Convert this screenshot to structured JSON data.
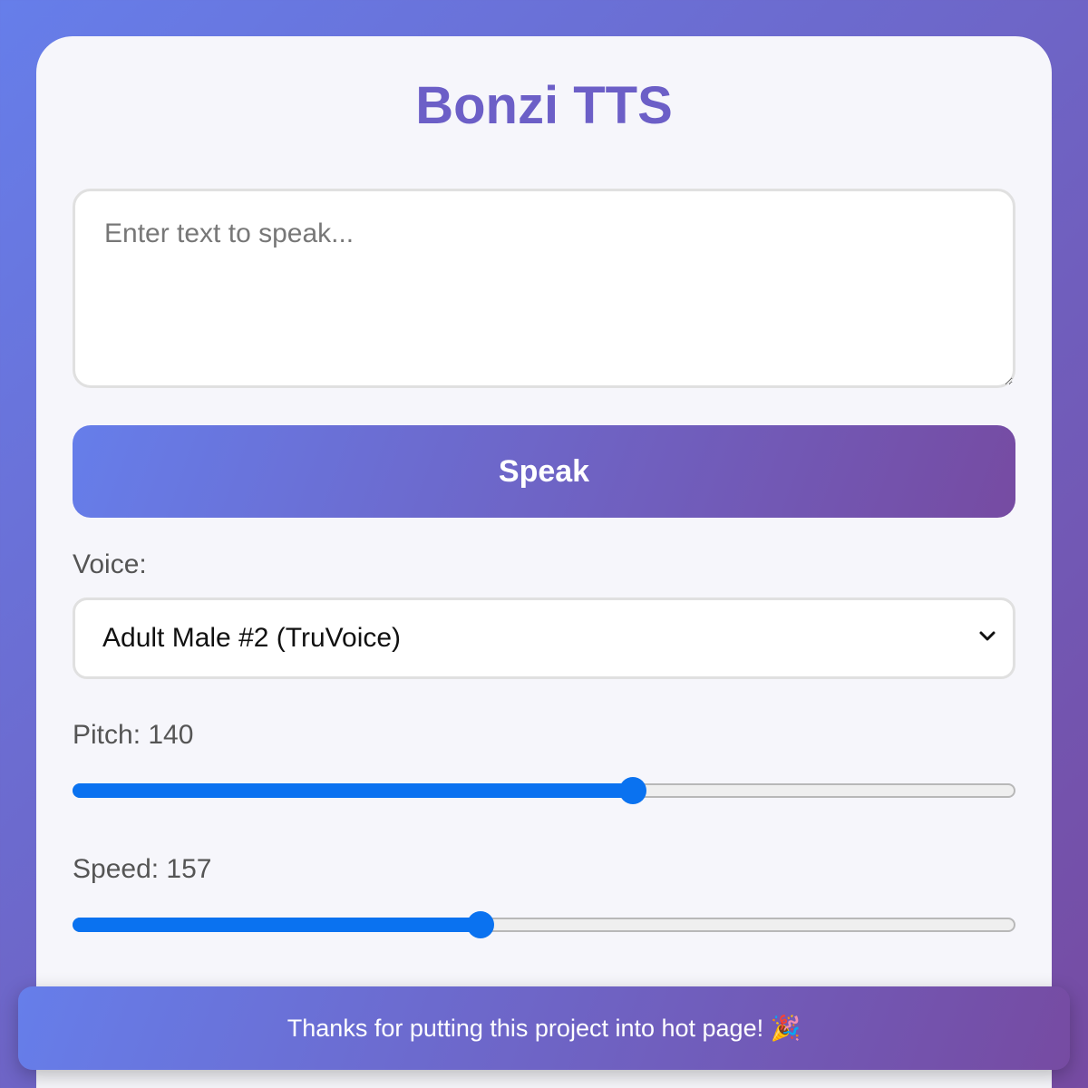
{
  "app": {
    "title": "Bonzi TTS"
  },
  "input": {
    "placeholder": "Enter text to speak...",
    "value": ""
  },
  "speak_button": {
    "label": "Speak"
  },
  "voice": {
    "label": "Voice:",
    "selected": "Adult Male #2 (TruVoice)"
  },
  "pitch": {
    "label": "Pitch: 140",
    "level_fraction": 0.597
  },
  "speed": {
    "label": "Speed: 157",
    "level_fraction": 0.431
  },
  "toast": {
    "message": "Thanks for putting this project into hot page! 🎉"
  },
  "colors": {
    "gradient_start": "#667eea",
    "gradient_end": "#764ba2",
    "title": "#6c5fc7",
    "slider_accent": "#0a72f0"
  }
}
